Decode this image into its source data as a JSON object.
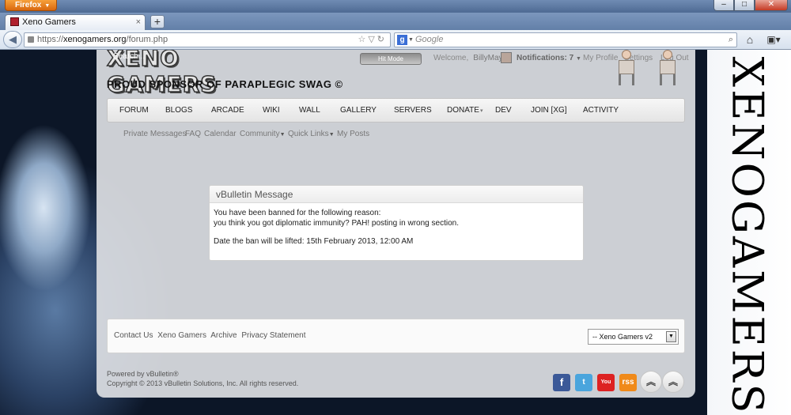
{
  "browser": {
    "app_button": "Firefox",
    "tab_title": "Xeno Gamers",
    "new_tab": "+",
    "url_prefix": "https://",
    "url_host": "xenogamers.org",
    "url_path": "/forum.php",
    "search_placeholder": "Google",
    "window_controls": [
      "–",
      "□",
      "✕"
    ]
  },
  "header": {
    "logo_text": "XENO GAMERS",
    "search_label": "Search...",
    "search_button": "Hit Mode",
    "welcome": "Welcome,",
    "username": "BillyMays",
    "notifications": "Notifications: 7",
    "my_profile": "My Profile",
    "settings": "Settings",
    "logout": "Log Out",
    "tagline": "PROUD SPONSOR OF PARAPLEGIC SWAG ©"
  },
  "menu": {
    "items": [
      "FORUM",
      "BLOGS",
      "ARCADE",
      "WIKI",
      "WALL",
      "GALLERY",
      "SERVERS",
      "DONATE",
      "DEV",
      "JOIN [XG]",
      "ACTIVITY"
    ]
  },
  "submenu": {
    "items": [
      "Private Messages",
      "FAQ",
      "Calendar",
      "Community",
      "Quick Links",
      "My Posts"
    ]
  },
  "message": {
    "title": "vBulletin Message",
    "line1": "You have been banned for the following reason:",
    "line2": "you think you got diplomatic immunity? PAH! posting in wrong section.",
    "line3": "Date the ban will be lifted: 15th February 2013, 12:00 AM"
  },
  "footer": {
    "links": [
      "Contact Us",
      "Xeno Gamers",
      "Archive",
      "Privacy Statement"
    ],
    "style_select": "-- Xeno Gamers v2",
    "powered_by": "Powered by vBulletin®",
    "copyright": "Copyright © 2013 vBulletin Solutions, Inc. All rights reserved."
  },
  "social": {
    "facebook": "f",
    "twitter": "t",
    "youtube": "You",
    "rss": "rss"
  },
  "side_logo": "XENOGAMERS"
}
